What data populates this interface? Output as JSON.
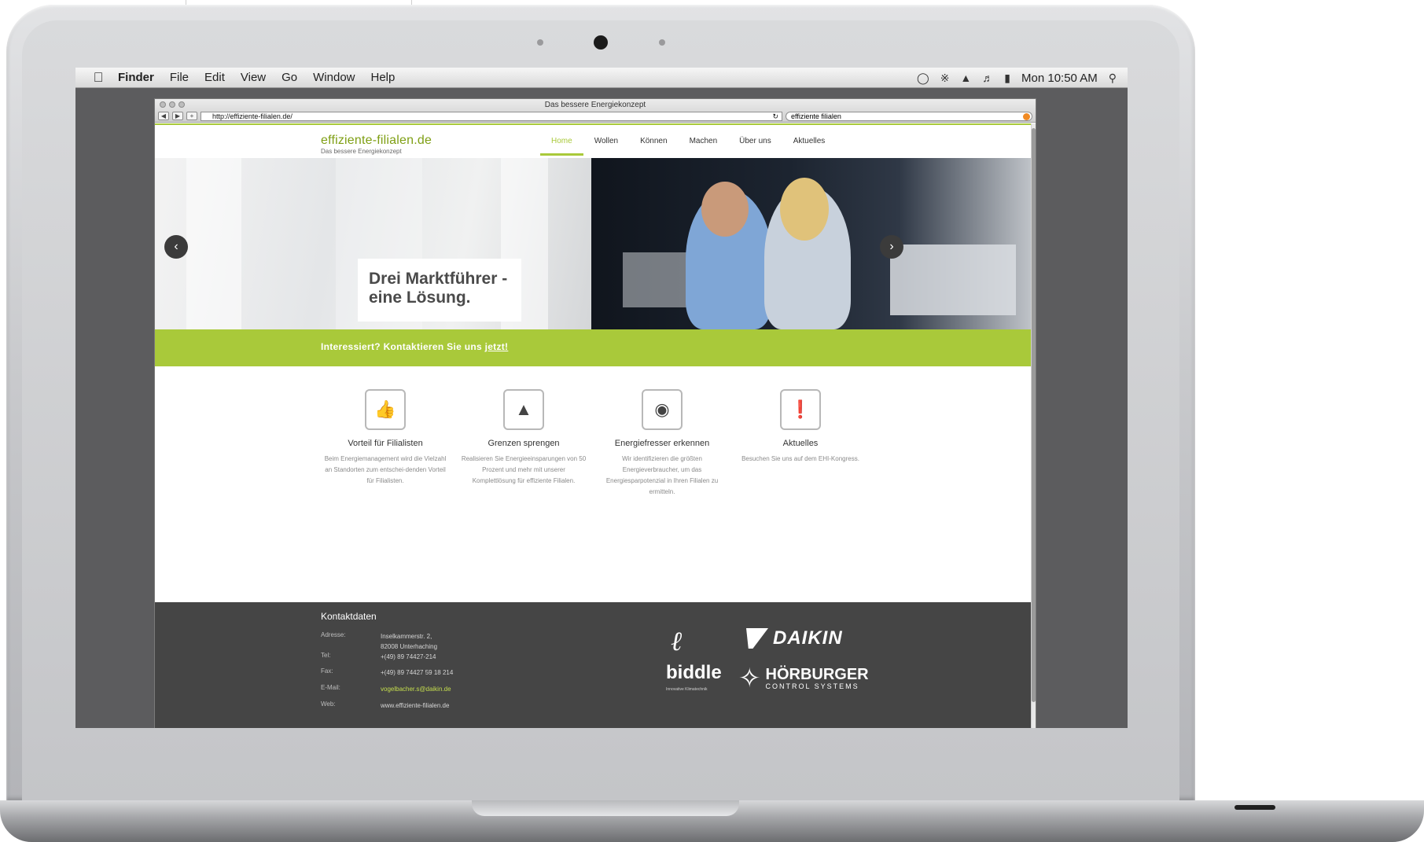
{
  "menubar": {
    "app": "Finder",
    "items": [
      "File",
      "Edit",
      "View",
      "Go",
      "Window",
      "Help"
    ],
    "clock": "Mon 10:50 AM"
  },
  "browser": {
    "title": "Das bessere Energiekonzept",
    "url": "http://effiziente-filialen.de/",
    "search_value": "effiziente filialen",
    "back": "◀",
    "forward": "▶",
    "add": "+"
  },
  "site": {
    "logo": "effiziente-filialen.de",
    "tagline": "Das bessere Energiekonzept",
    "nav": [
      "Home",
      "Wollen",
      "Können",
      "Machen",
      "Über uns",
      "Aktuelles"
    ],
    "active_nav": "Home",
    "hero": {
      "headline": "Drei Marktführer -\neine Lösung."
    },
    "cta": {
      "text": "Interessiert? Kontaktieren Sie uns ",
      "link": "jetzt!"
    },
    "features": [
      {
        "icon": "thumbs-up-icon",
        "title": "Vorteil für Filialisten",
        "text": "Beim Energiemanagement wird die Vielzahl an Standorten zum entschei-denden Vorteil für Filialisten."
      },
      {
        "icon": "rocket-icon",
        "title": "Grenzen sprengen",
        "text": "Realisieren Sie Energieeinsparungen von 50 Prozent und mehr mit unserer Komplettlösung für effiziente Filialen."
      },
      {
        "icon": "eye-icon",
        "title": "Energiefresser erkennen",
        "text": "Wir identifizieren die größten Energieverbraucher, um das Energiesparpotenzial in Ihren Filialen zu ermitteln."
      },
      {
        "icon": "exclamation-icon",
        "title": "Aktuelles",
        "text": "Besuchen Sie uns auf dem EHI-Kongress."
      }
    ],
    "footer": {
      "title": "Kontaktdaten",
      "rows": [
        {
          "label": "Adresse:",
          "value": "Inselkammerstr. 2,\n82008 Unterhaching"
        },
        {
          "label": "Tel:",
          "value": "+(49) 89 74427-214"
        },
        {
          "label": "Fax:",
          "value": "+(49) 89 74427 59 18 214"
        },
        {
          "label": "E-Mail:",
          "value": "vogelbacher.s@daikin.de"
        },
        {
          "label": "Web:",
          "value": "www.effiziente-filialen.de"
        }
      ],
      "logos": {
        "biddle": "biddle",
        "biddle_sub": "Innovative Klimatechnik",
        "daikin": "DAIKIN",
        "hoerburger": "HÖRBURGER",
        "hoerburger_sub": "CONTROL SYSTEMS"
      }
    }
  },
  "colors": {
    "accent": "#a9c93a",
    "logo_green": "#7f9f14",
    "footer_bg": "#454545"
  }
}
